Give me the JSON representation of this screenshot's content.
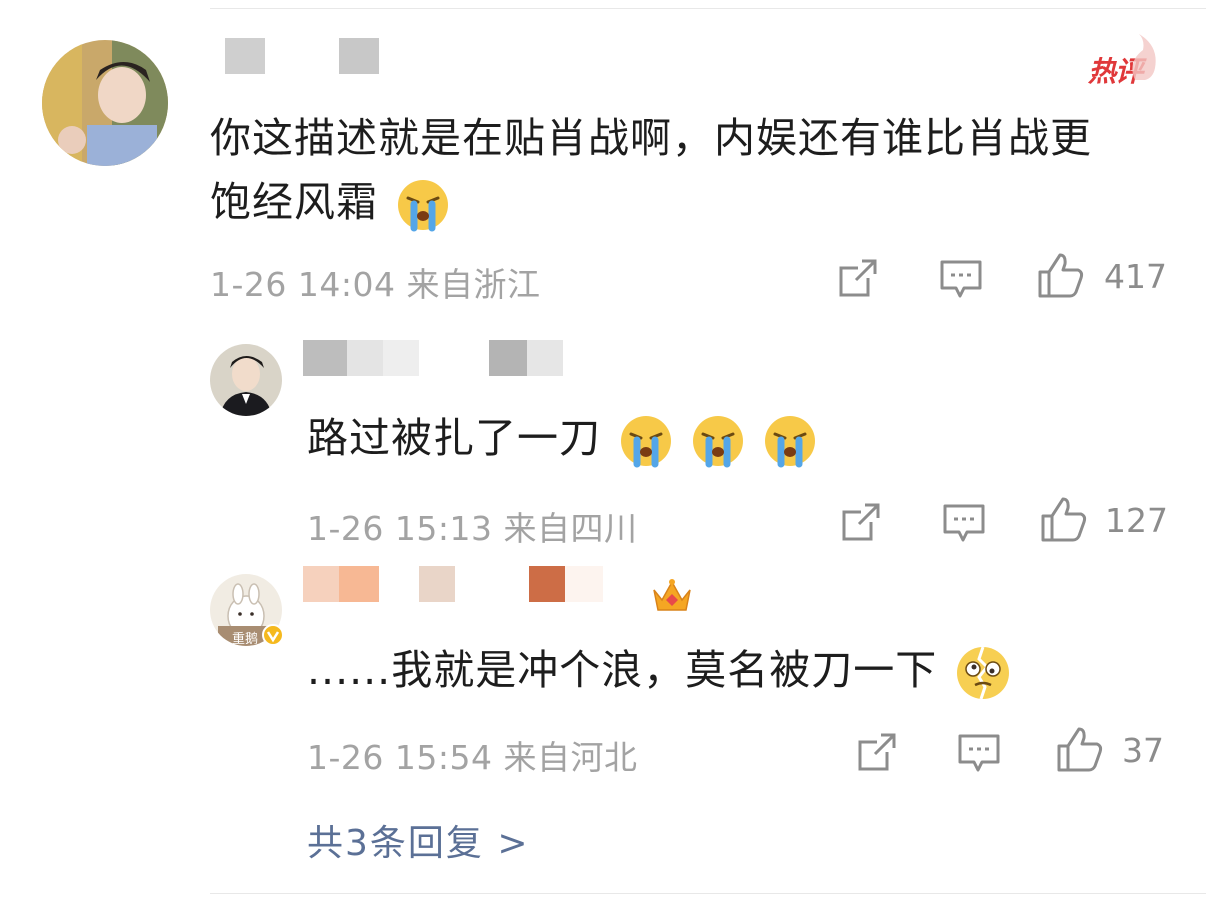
{
  "main_comment": {
    "badge": "热评",
    "text": "你这描述就是在贴肖战啊，内娱还有谁比肖战更饱经风霜",
    "text_line1": "你这描述就是在贴肖战啊，内娱还有谁比肖战更",
    "text_line2": "饱经风霜",
    "emoji": [
      "crying-face"
    ],
    "meta": "1-26 14:04 来自浙江",
    "likes": "417"
  },
  "replies": [
    {
      "text": "路过被扎了一刀",
      "emoji": [
        "crying-face",
        "crying-face",
        "crying-face"
      ],
      "meta": "1-26 15:13 来自四川",
      "likes": "127"
    },
    {
      "text": "......我就是冲个浪，莫名被刀一下",
      "emoji": [
        "broken-face"
      ],
      "meta": "1-26 15:54 来自河北",
      "likes": "37",
      "avatar_caption": "重鹅"
    }
  ],
  "more_replies": "共3条回复 >",
  "colors": {
    "link": "#5b7096",
    "hot": "#e0383a",
    "meta": "#a3a3a3"
  }
}
